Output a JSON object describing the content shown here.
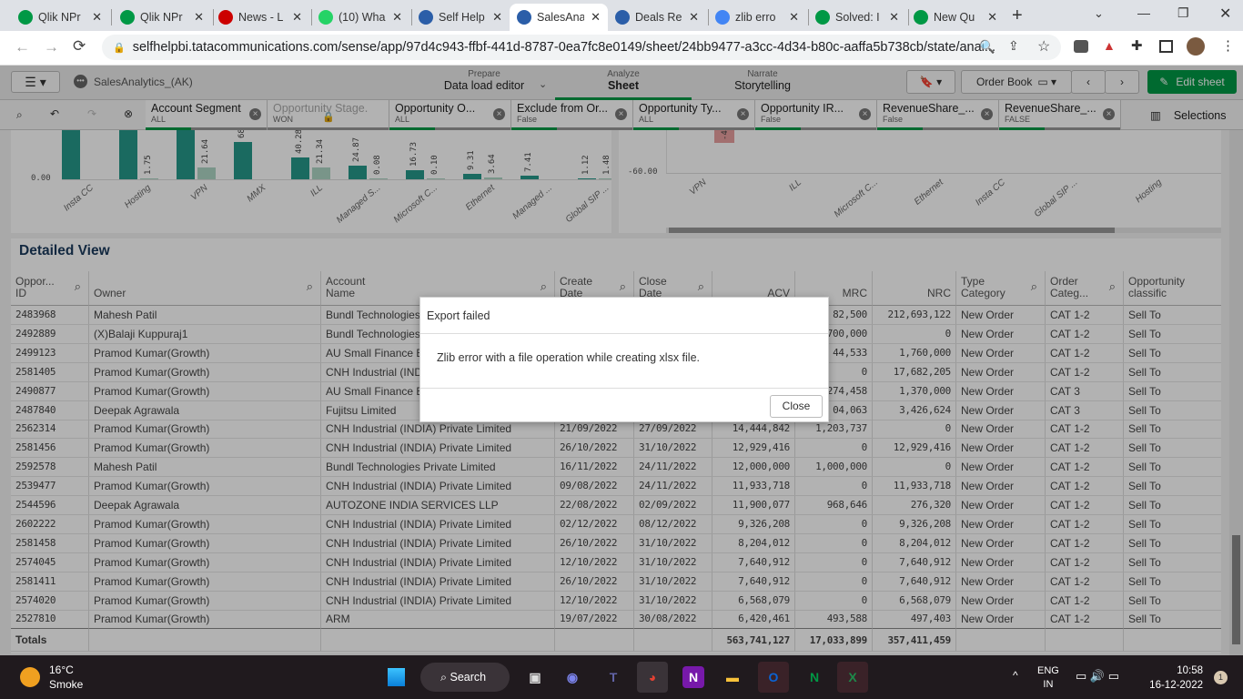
{
  "browser": {
    "tabs": [
      {
        "title": "Qlik NPr",
        "icon": "qlik-n-icon",
        "color": "#009845"
      },
      {
        "title": "Qlik NPr",
        "icon": "qlik-n-icon",
        "color": "#009845"
      },
      {
        "title": "News - L",
        "icon": "toi-icon",
        "color": "#c00"
      },
      {
        "title": "(10) Wha",
        "icon": "whatsapp-icon",
        "color": "#25d366"
      },
      {
        "title": "Self Help",
        "icon": "tata-icon",
        "color": "#2b5ea8"
      },
      {
        "title": "SalesAna",
        "icon": "tata-icon",
        "color": "#2b5ea8"
      },
      {
        "title": "Deals Re",
        "icon": "tata-icon",
        "color": "#2b5ea8"
      },
      {
        "title": "zlib erro",
        "icon": "google-icon",
        "color": "#4285f4"
      },
      {
        "title": "Solved: I",
        "icon": "qlik-q-icon",
        "color": "#009845"
      },
      {
        "title": "New Qu",
        "icon": "qlik-q-icon",
        "color": "#009845"
      }
    ],
    "active_tab": 5,
    "url": "selfhelpbi.tatacommunications.com/sense/app/97d4c943-ffbf-441d-8787-0ea7fc8e0149/sheet/24bb9477-a3cc-4d34-b80c-aaffa5b738cb/state/anal..."
  },
  "qlik": {
    "app_name": "SalesAnalytics_(AK)",
    "nav": [
      {
        "small": "Prepare",
        "big": "Data load editor"
      },
      {
        "small": "Analyze",
        "big": "Sheet"
      },
      {
        "small": "Narrate",
        "big": "Storytelling"
      }
    ],
    "sheet_name": "Order Book",
    "edit_sheet": "Edit sheet",
    "selections_label": "Selections",
    "filters": [
      {
        "field": "Account Segment",
        "value": "ALL",
        "locked": false
      },
      {
        "field": "Opportunity Stage...",
        "value": "WON",
        "locked": true
      },
      {
        "field": "Opportunity O...",
        "value": "ALL",
        "locked": false
      },
      {
        "field": "Exclude from Or...",
        "value": "False",
        "locked": false
      },
      {
        "field": "Opportunity Ty...",
        "value": "ALL",
        "locked": false
      },
      {
        "field": "Opportunity IR...",
        "value": "False",
        "locked": false
      },
      {
        "field": "RevenueShare_...",
        "value": "False",
        "locked": false
      },
      {
        "field": "RevenueShare_...",
        "value": "FALSE",
        "locked": false
      }
    ]
  },
  "chart_data": [
    {
      "type": "bar",
      "categories": [
        "Insta CC",
        "Hosting",
        "VPN",
        "MMX",
        "ILL",
        "Managed S...",
        "Microsoft C...",
        "Ethernet",
        "Managed ...",
        "Global SIP ..."
      ],
      "series": [
        {
          "values": [
            null,
            null,
            null,
            68,
            40.28,
            24.87,
            16.73,
            9.31,
            7.41,
            1.12
          ],
          "labels": [
            "",
            "",
            "",
            "68",
            "40.28",
            "24.87",
            "16.73",
            "9.31",
            "7.41",
            "1.12"
          ],
          "color": "#26998a"
        },
        {
          "values": [
            null,
            1.75,
            21.64,
            null,
            21.34,
            0.08,
            0.1,
            3.64,
            null,
            1.48
          ],
          "labels": [
            "",
            "1.75",
            "21.64",
            "",
            "21.34",
            "0.08",
            "0.10",
            "3.64",
            "",
            "1.48"
          ],
          "color": "#aed6c5"
        }
      ],
      "y_tick": "0.00"
    },
    {
      "type": "bar",
      "categories": [
        "VPN",
        "ILL",
        "Microsoft C...",
        "Ethernet",
        "Insta CC",
        "Global SIP ...",
        "Hosting"
      ],
      "marker_label": "-4",
      "y_tick": "-60.00",
      "marker_color": "#e8a0a0"
    }
  ],
  "table": {
    "title": "Detailed View",
    "columns": [
      "Oppor... ID",
      "Owner",
      "Account Name",
      "Create Date",
      "Close Date",
      "ACV",
      "MRC",
      "NRC",
      "Type Category",
      "Order Categ...",
      "Opportunity classific"
    ],
    "rows": [
      [
        "2483968",
        "Mahesh Patil",
        "Bundl Technologies",
        "",
        "",
        "",
        "82,500",
        "212,693,122",
        "New Order",
        "CAT 1-2",
        "Sell To"
      ],
      [
        "2492889",
        "(X)Balaji Kuppuraj1",
        "Bundl Technologies",
        "",
        "",
        "",
        "700,000",
        "0",
        "New Order",
        "CAT 1-2",
        "Sell To"
      ],
      [
        "2499123",
        "Pramod Kumar(Growth)",
        "AU Small Finance Ba",
        "",
        "",
        "",
        "44,533",
        "1,760,000",
        "New Order",
        "CAT 1-2",
        "Sell To"
      ],
      [
        "2581405",
        "Pramod Kumar(Growth)",
        "CNH Industrial (IND",
        "",
        "",
        "",
        "0",
        "17,682,205",
        "New Order",
        "CAT 1-2",
        "Sell To"
      ],
      [
        "2490877",
        "Pramod Kumar(Growth)",
        "AU Small Finance Ba",
        "",
        "",
        "",
        "274,458",
        "1,370,000",
        "New Order",
        "CAT 3",
        "Sell To"
      ],
      [
        "2487840",
        "Deepak Agrawala",
        "Fujitsu Limited",
        "",
        "",
        "",
        "04,063",
        "3,426,624",
        "New Order",
        "CAT 3",
        "Sell To"
      ],
      [
        "2562314",
        "Pramod Kumar(Growth)",
        "CNH Industrial (INDIA) Private Limited",
        "21/09/2022",
        "27/09/2022",
        "14,444,842",
        "1,203,737",
        "0",
        "New Order",
        "CAT 1-2",
        "Sell To"
      ],
      [
        "2581456",
        "Pramod Kumar(Growth)",
        "CNH Industrial (INDIA) Private Limited",
        "26/10/2022",
        "31/10/2022",
        "12,929,416",
        "0",
        "12,929,416",
        "New Order",
        "CAT 1-2",
        "Sell To"
      ],
      [
        "2592578",
        "Mahesh Patil",
        "Bundl Technologies Private Limited",
        "16/11/2022",
        "24/11/2022",
        "12,000,000",
        "1,000,000",
        "0",
        "New Order",
        "CAT 1-2",
        "Sell To"
      ],
      [
        "2539477",
        "Pramod Kumar(Growth)",
        "CNH Industrial (INDIA) Private Limited",
        "09/08/2022",
        "24/11/2022",
        "11,933,718",
        "0",
        "11,933,718",
        "New Order",
        "CAT 1-2",
        "Sell To"
      ],
      [
        "2544596",
        "Deepak Agrawala",
        "AUTOZONE INDIA SERVICES LLP",
        "22/08/2022",
        "02/09/2022",
        "11,900,077",
        "968,646",
        "276,320",
        "New Order",
        "CAT 1-2",
        "Sell To"
      ],
      [
        "2602222",
        "Pramod Kumar(Growth)",
        "CNH Industrial (INDIA) Private Limited",
        "02/12/2022",
        "08/12/2022",
        "9,326,208",
        "0",
        "9,326,208",
        "New Order",
        "CAT 1-2",
        "Sell To"
      ],
      [
        "2581458",
        "Pramod Kumar(Growth)",
        "CNH Industrial (INDIA) Private Limited",
        "26/10/2022",
        "31/10/2022",
        "8,204,012",
        "0",
        "8,204,012",
        "New Order",
        "CAT 1-2",
        "Sell To"
      ],
      [
        "2574045",
        "Pramod Kumar(Growth)",
        "CNH Industrial (INDIA) Private Limited",
        "12/10/2022",
        "31/10/2022",
        "7,640,912",
        "0",
        "7,640,912",
        "New Order",
        "CAT 1-2",
        "Sell To"
      ],
      [
        "2581411",
        "Pramod Kumar(Growth)",
        "CNH Industrial (INDIA) Private Limited",
        "26/10/2022",
        "31/10/2022",
        "7,640,912",
        "0",
        "7,640,912",
        "New Order",
        "CAT 1-2",
        "Sell To"
      ],
      [
        "2574020",
        "Pramod Kumar(Growth)",
        "CNH Industrial (INDIA) Private Limited",
        "12/10/2022",
        "31/10/2022",
        "6,568,079",
        "0",
        "6,568,079",
        "New Order",
        "CAT 1-2",
        "Sell To"
      ],
      [
        "2527810",
        "Pramod Kumar(Growth)",
        "ARM",
        "19/07/2022",
        "30/08/2022",
        "6,420,461",
        "493,588",
        "497,403",
        "New Order",
        "CAT 1-2",
        "Sell To"
      ]
    ],
    "totals": [
      "Totals",
      "",
      "",
      "",
      "",
      "563,741,127",
      "17,033,899",
      "357,411,459",
      "",
      "",
      ""
    ]
  },
  "dialog": {
    "title": "Export failed",
    "message": "Zlib error with a file operation while creating xlsx file.",
    "close": "Close"
  },
  "taskbar": {
    "temp": "16°C",
    "weather": "Smoke",
    "search": "Search",
    "lang1": "ENG",
    "lang2": "IN",
    "time": "10:58",
    "date": "16-12-2022",
    "notif": "1"
  }
}
